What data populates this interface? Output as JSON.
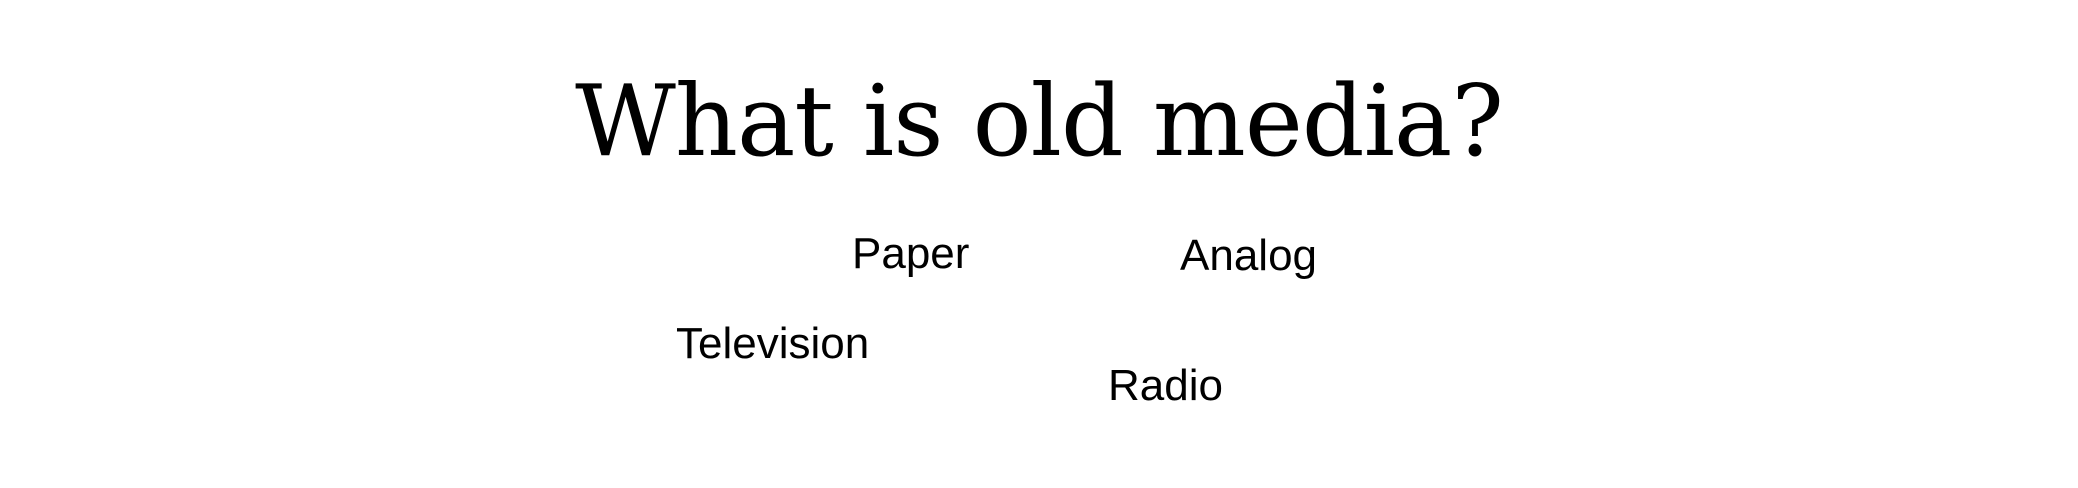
{
  "slide": {
    "title": "What is old media?",
    "words": {
      "paper": "Paper",
      "analog": "Analog",
      "television": "Television",
      "radio": "Radio"
    }
  }
}
